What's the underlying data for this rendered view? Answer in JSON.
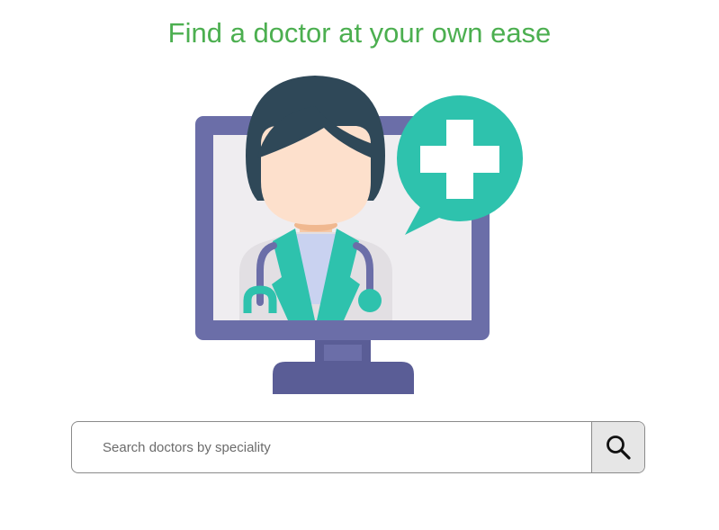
{
  "header": {
    "title": "Find a doctor at your own ease"
  },
  "hero": {
    "illustration": "doctor-on-monitor-with-medical-cross",
    "icons": [
      "monitor-icon",
      "doctor-avatar-icon",
      "stethoscope-icon",
      "medical-cross-speech-bubble-icon"
    ]
  },
  "search": {
    "placeholder": "Search doctors by speciality",
    "value": "",
    "button_icon": "search-icon"
  },
  "colors": {
    "title": "#4caf50",
    "monitor_frame": "#6b6ea8",
    "monitor_stand": "#5a5d96",
    "screen": "#efedf0",
    "teal_accent": "#2ec2ad",
    "hair": "#2f4858",
    "skin": "#fde0cc",
    "search_button_bg": "#e6e6e6"
  }
}
